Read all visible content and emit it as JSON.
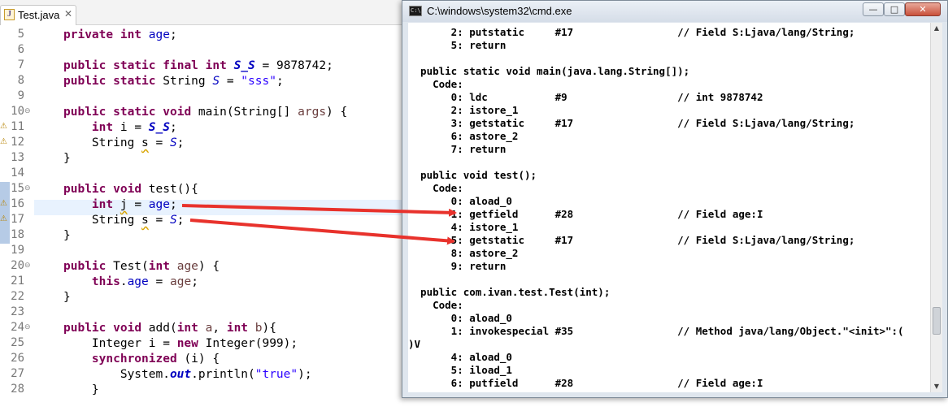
{
  "editor": {
    "tab_title": "Test.java",
    "tab_close": "✕",
    "tab_icon": "J",
    "line_numbers": [
      "5",
      "6",
      "7",
      "8",
      "9",
      "10",
      "11",
      "12",
      "13",
      "14",
      "15",
      "16",
      "17",
      "18",
      "19",
      "20",
      "21",
      "22",
      "23",
      "24",
      "25",
      "26",
      "27",
      "28"
    ],
    "fold_markers": [
      "⊖",
      "⊖",
      "⊖",
      "⊖"
    ],
    "code": [
      {
        "t": "    private int age;"
      },
      {
        "t": ""
      },
      {
        "t": "    public static final int S_S = 9878742;"
      },
      {
        "t": "    public static String S = \"sss\";"
      },
      {
        "t": ""
      },
      {
        "t": "    public static void main(String[] args) {"
      },
      {
        "t": "        int i = S_S;"
      },
      {
        "t": "        String s = S;"
      },
      {
        "t": "    }"
      },
      {
        "t": ""
      },
      {
        "t": "    public void test(){"
      },
      {
        "t": "        int j = age;"
      },
      {
        "t": "        String s = S;"
      },
      {
        "t": "    }"
      },
      {
        "t": ""
      },
      {
        "t": "    public Test(int age) {"
      },
      {
        "t": "        this.age = age;"
      },
      {
        "t": "    }"
      },
      {
        "t": ""
      },
      {
        "t": "    public void add(int a, int b){"
      },
      {
        "t": "        Integer i = new Integer(999);"
      },
      {
        "t": "        synchronized (i) {"
      },
      {
        "t": "            System.out.println(\"true\");"
      },
      {
        "t": "        }"
      }
    ]
  },
  "cmd": {
    "title": "C:\\windows\\system32\\cmd.exe",
    "icon": "C:\\",
    "btn_min": "—",
    "btn_max": "□",
    "btn_close": "✕",
    "scroll_up": "▲",
    "scroll_down": "▼",
    "lines": [
      "       2: putstatic     #17                 // Field S:Ljava/lang/String;",
      "       5: return",
      "",
      "  public static void main(java.lang.String[]);",
      "    Code:",
      "       0: ldc           #9                  // int 9878742",
      "       2: istore_1",
      "       3: getstatic     #17                 // Field S:Ljava/lang/String;",
      "       6: astore_2",
      "       7: return",
      "",
      "  public void test();",
      "    Code:",
      "       0: aload_0",
      "       1: getfield      #28                 // Field age:I",
      "       4: istore_1",
      "       5: getstatic     #17                 // Field S:Ljava/lang/String;",
      "       8: astore_2",
      "       9: return",
      "",
      "  public com.ivan.test.Test(int);",
      "    Code:",
      "       0: aload_0",
      "       1: invokespecial #35                 // Method java/lang/Object.\"<init>\":(",
      ")V",
      "       4: aload_0",
      "       5: iload_1",
      "       6: putfield      #28                 // Field age:I"
    ]
  },
  "annotations": {
    "arrow_color": "#e8322c",
    "arrows": [
      "age-to-getfield",
      "S-to-getstatic"
    ]
  }
}
